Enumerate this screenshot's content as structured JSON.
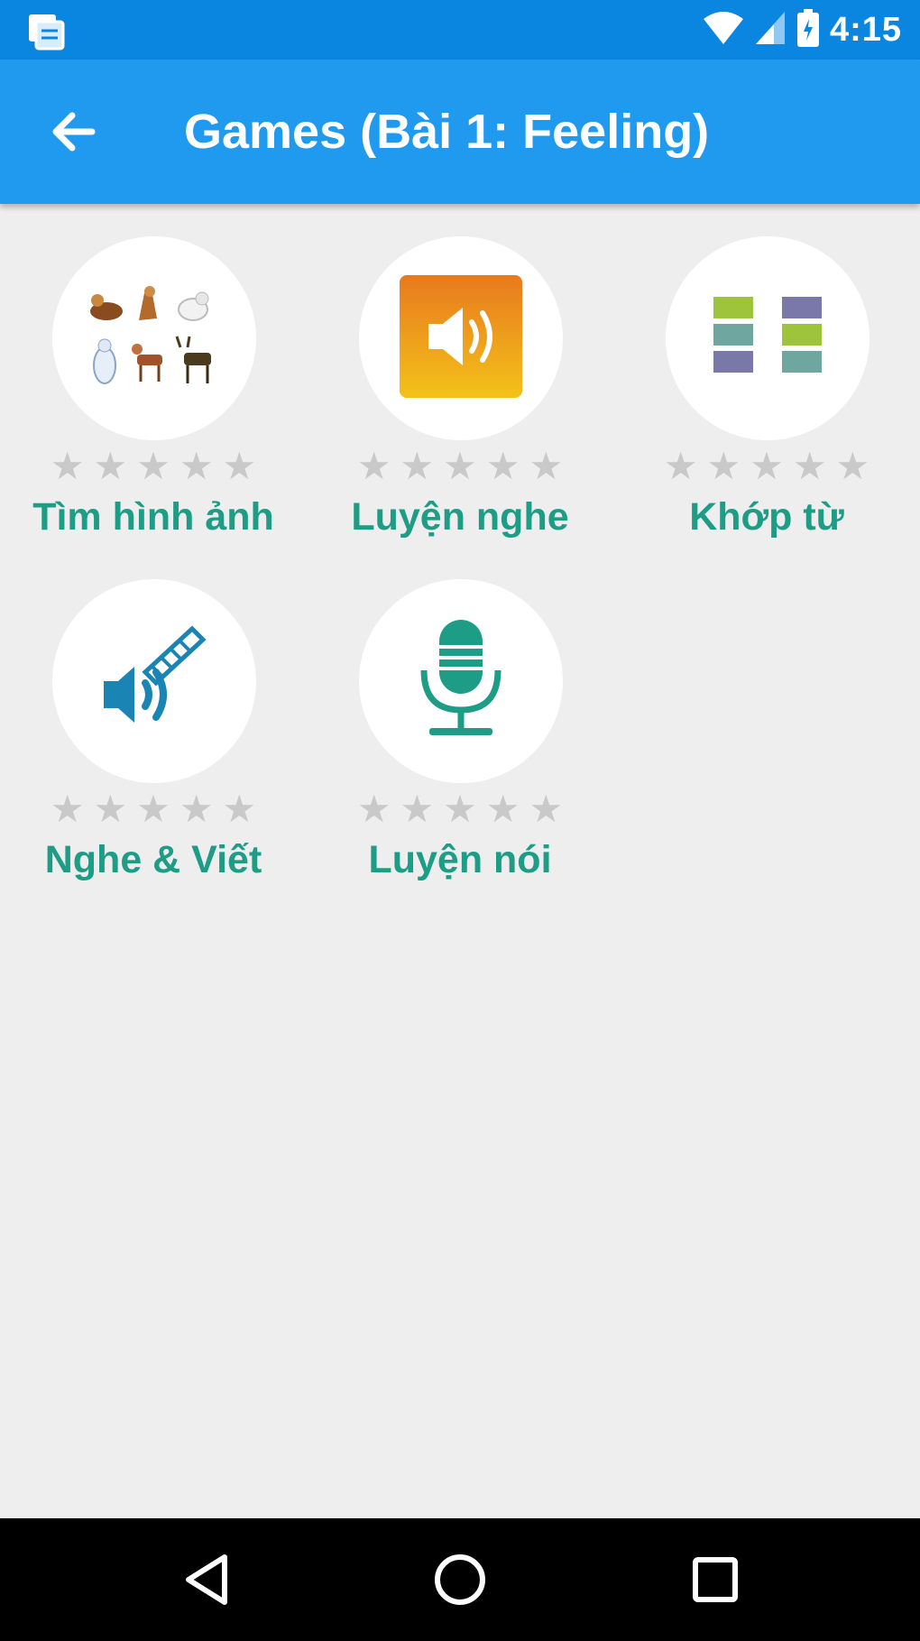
{
  "status_bar": {
    "time": "4:15",
    "icons": [
      "notification-icon",
      "wifi-icon",
      "signal-icon",
      "battery-icon"
    ]
  },
  "app_bar": {
    "title": "Games (Bài 1: Feeling)",
    "back_icon": "arrow-back-icon"
  },
  "games": [
    {
      "label": "Tìm hình ảnh",
      "icon": "animal-pictures-icon",
      "rating": 0,
      "max_rating": 5
    },
    {
      "label": "Luyện nghe",
      "icon": "speaker-icon",
      "rating": 0,
      "max_rating": 5
    },
    {
      "label": "Khớp từ",
      "icon": "match-words-icon",
      "rating": 0,
      "max_rating": 5
    },
    {
      "label": "Nghe & Viết",
      "icon": "listen-write-icon",
      "rating": 0,
      "max_rating": 5
    },
    {
      "label": "Luyện nói",
      "icon": "microphone-icon",
      "rating": 0,
      "max_rating": 5
    }
  ],
  "nav_bar": {
    "buttons": [
      "back-triangle-icon",
      "home-circle-icon",
      "recents-square-icon"
    ]
  },
  "colors": {
    "status_bar": "#0a86e0",
    "app_bar": "#1f9aee",
    "background": "#eeeeee",
    "label": "#1e9d86",
    "star_empty": "#c9c9c9"
  }
}
